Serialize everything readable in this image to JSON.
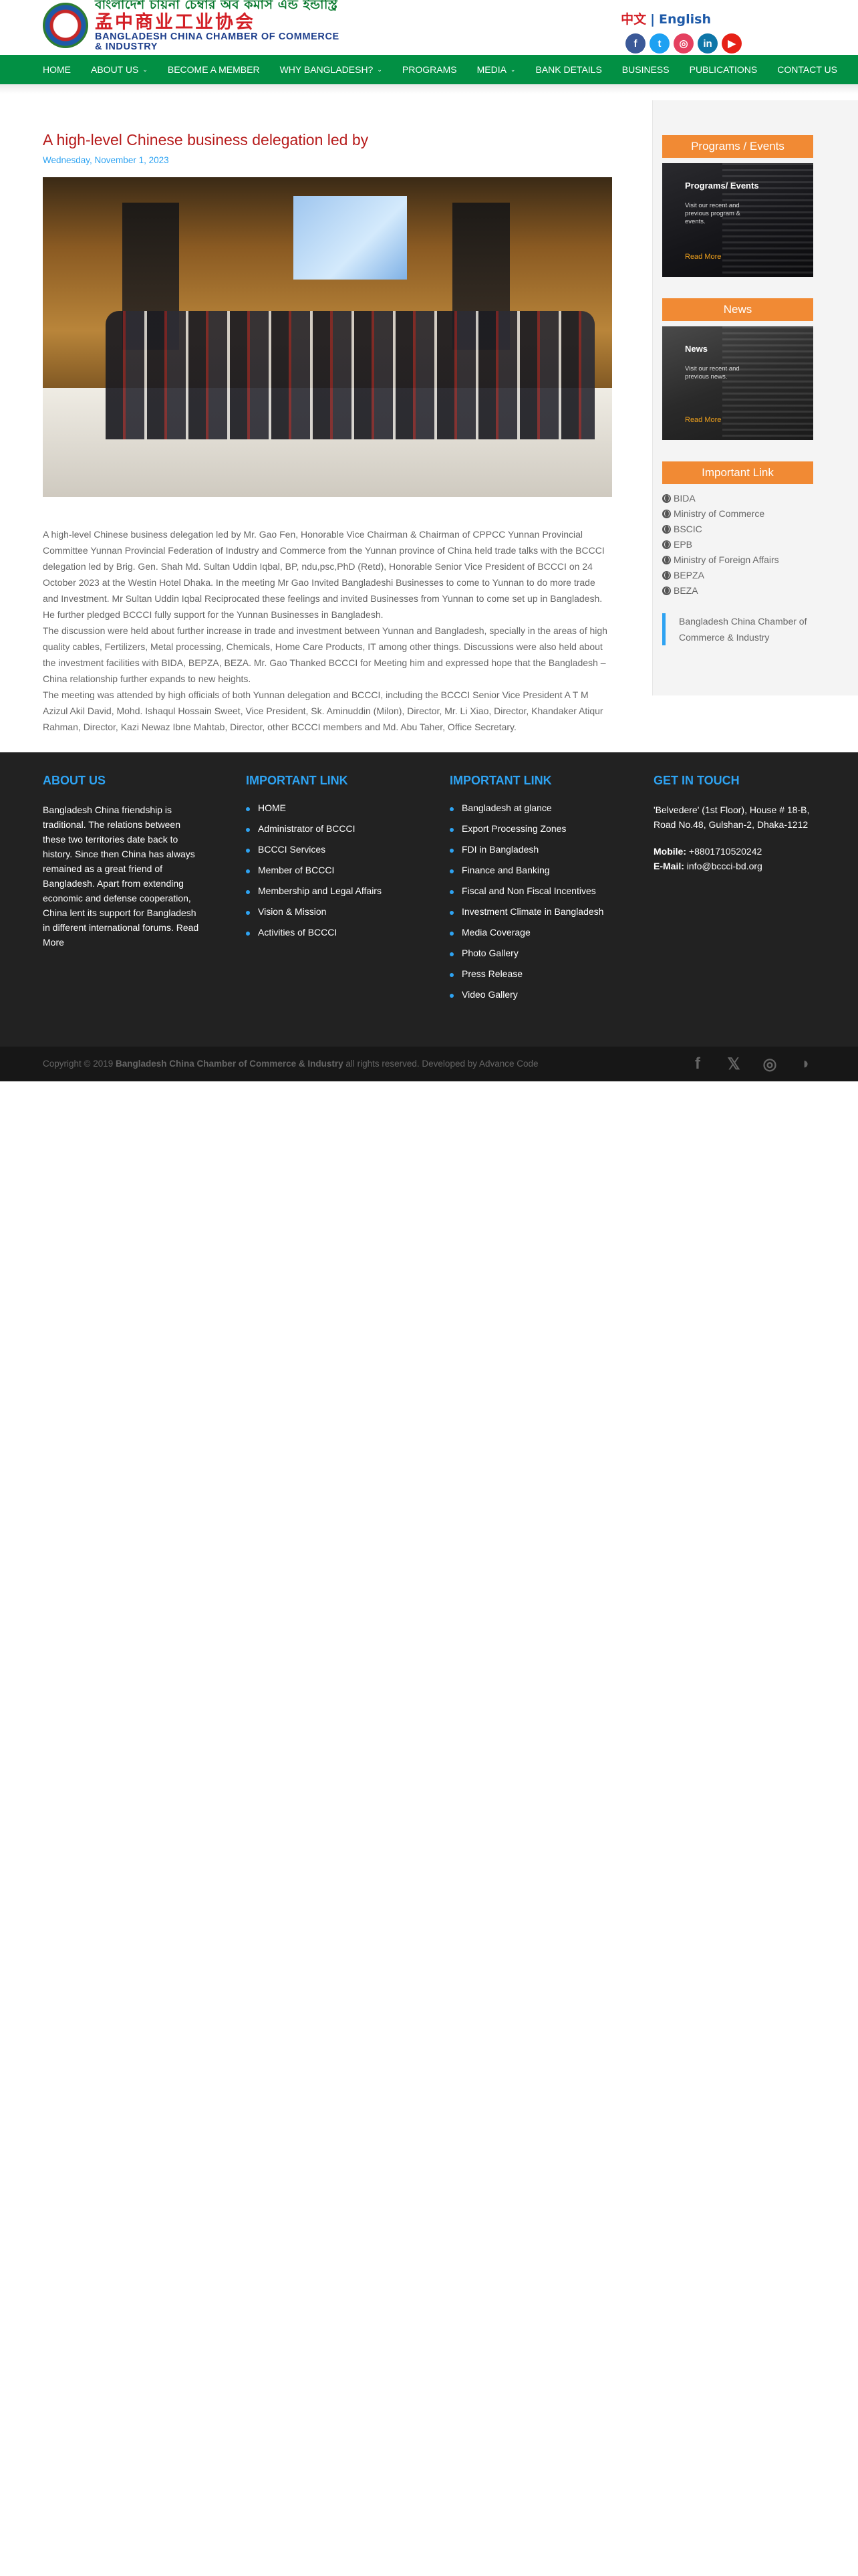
{
  "header": {
    "logo_bn": "বাংলাদেশ চায়না চেম্বার অব কমার্স এন্ড ইন্ডাস্ট্রি",
    "logo_cn": "孟中商业工业协会",
    "logo_en": "BANGLADESH CHINA CHAMBER OF COMMERCE & INDUSTRY",
    "lang_cn": "中文",
    "lang_sep": "|",
    "lang_en": "English",
    "social": [
      {
        "icon": "facebook-icon",
        "glyph": "f"
      },
      {
        "icon": "twitter-icon",
        "glyph": "t"
      },
      {
        "icon": "instagram-icon",
        "glyph": "◎"
      },
      {
        "icon": "linkedin-icon",
        "glyph": "in"
      },
      {
        "icon": "youtube-icon",
        "glyph": "▶"
      }
    ]
  },
  "nav": {
    "items": [
      {
        "label": "HOME",
        "dropdown": false
      },
      {
        "label": "ABOUT US",
        "dropdown": true
      },
      {
        "label": "BECOME A MEMBER",
        "dropdown": false
      },
      {
        "label": "WHY BANGLADESH?",
        "dropdown": true
      },
      {
        "label": "PROGRAMS",
        "dropdown": false
      },
      {
        "label": "MEDIA",
        "dropdown": true
      },
      {
        "label": "BANK DETAILS",
        "dropdown": false
      },
      {
        "label": "BUSINESS",
        "dropdown": false
      },
      {
        "label": "PUBLICATIONS",
        "dropdown": false
      },
      {
        "label": "CONTACT US",
        "dropdown": false
      }
    ],
    "chevron": "⌄"
  },
  "article": {
    "title": "A high-level Chinese business delegation led by",
    "date": "Wednesday, November 1, 2023",
    "paragraphs": [
      "A high-level Chinese business delegation led by Mr. Gao Fen, Honorable Vice Chairman & Chairman of CPPCC Yunnan Provincial Committee Yunnan Provincial Federation of Industry and Commerce from the Yunnan province of China held trade talks with the BCCCI delegation led by Brig. Gen. Shah Md. Sultan Uddin Iqbal, BP, ndu,psc,PhD (Retd), Honorable Senior Vice President of BCCCI on 24 October 2023 at the Westin Hotel Dhaka. In the meeting Mr Gao Invited Bangladeshi Businesses to come to Yunnan to do more trade and Investment. Mr Sultan Uddin Iqbal Reciprocated these feelings and invited Businesses from Yunnan to come set up in Bangladesh. He further pledged BCCCI fully support for the Yunnan Businesses in Bangladesh.",
      "The discussion were held about further increase in trade and investment between Yunnan and Bangladesh, specially in the areas of high quality cables, Fertilizers, Metal processing, Chemicals, Home Care Products, IT among other things. Discussions were also held about the investment facilities with BIDA, BEPZA, BEZA. Mr. Gao Thanked BCCCI for Meeting him and expressed hope that the Bangladesh – China relationship further expands to new heights.",
      "The meeting was attended by high officials of both Yunnan delegation and BCCCI, including the BCCCI Senior Vice President A T M Azizul Akil David, Mohd. Ishaqul Hossain Sweet, Vice President, Sk. Aminuddin (Milon), Director, Mr. Li Xiao, Director, Khandaker Atiqur Rahman, Director, Kazi Newaz Ibne Mahtab, Director, other BCCCI members and Md. Abu Taher, Office Secretary."
    ]
  },
  "sidebar": {
    "programs": {
      "heading": "Programs / Events",
      "card_title": "Programs/ Events",
      "card_desc": "Visit our recent and previous program & events.",
      "card_link": "Read More"
    },
    "news": {
      "heading": "News",
      "card_title": "News",
      "card_desc": "Visit our recent and previous news.",
      "card_link": "Read More"
    },
    "important": {
      "heading": "Important Link",
      "links": [
        "BIDA",
        "Ministry of Commerce",
        "BSCIC",
        "EPB",
        "Ministry of Foreign Affairs",
        "BEPZA",
        "BEZA"
      ]
    },
    "quote": "Bangladesh China Chamber of Commerce & Industry"
  },
  "footer": {
    "about": {
      "heading": "ABOUT US",
      "text": "Bangladesh China friendship is traditional. The relations between these two territories date back to history. Since then China has always remained as a great friend of Bangladesh. Apart from extending economic and defense cooperation, China lent its support for Bangladesh in different international forums. Read More"
    },
    "links1": {
      "heading": "IMPORTANT LINK",
      "items": [
        "HOME",
        "Administrator of BCCCI",
        "BCCCI Services",
        "Member of BCCCI",
        "Membership and Legal Affairs",
        "Vision & Mission",
        "Activities of BCCCI"
      ]
    },
    "links2": {
      "heading": "IMPORTANT LINK",
      "items": [
        "Bangladesh at glance",
        "Export Processing Zones",
        "FDI in Bangladesh",
        "Finance and Banking",
        "Fiscal and Non Fiscal Incentives",
        "Investment Climate in Bangladesh",
        "Media Coverage",
        "Photo Gallery",
        "Press Release",
        "Video Gallery"
      ]
    },
    "contact": {
      "heading": "GET IN TOUCH",
      "address": "'Belvedere' (1st Floor), House # 18-B, Road No.48, Gulshan-2, Dhaka-1212",
      "mobile_label": "Mobile:",
      "mobile": "+8801710520242",
      "email_label": "E-Mail:",
      "email": "info@bccci-bd.org"
    }
  },
  "bottom": {
    "copy_prefix": "Copyright © 2019",
    "copy_org": "Bangladesh China Chamber of Commerce & Industry",
    "copy_suffix": "all rights reserved. Developed by Advance Code",
    "social": [
      {
        "icon": "facebook-icon",
        "glyph": "f"
      },
      {
        "icon": "x-twitter-icon",
        "glyph": "𝕏"
      },
      {
        "icon": "instagram-icon",
        "glyph": "◎"
      },
      {
        "icon": "rss-icon",
        "glyph": "◗"
      }
    ]
  }
}
